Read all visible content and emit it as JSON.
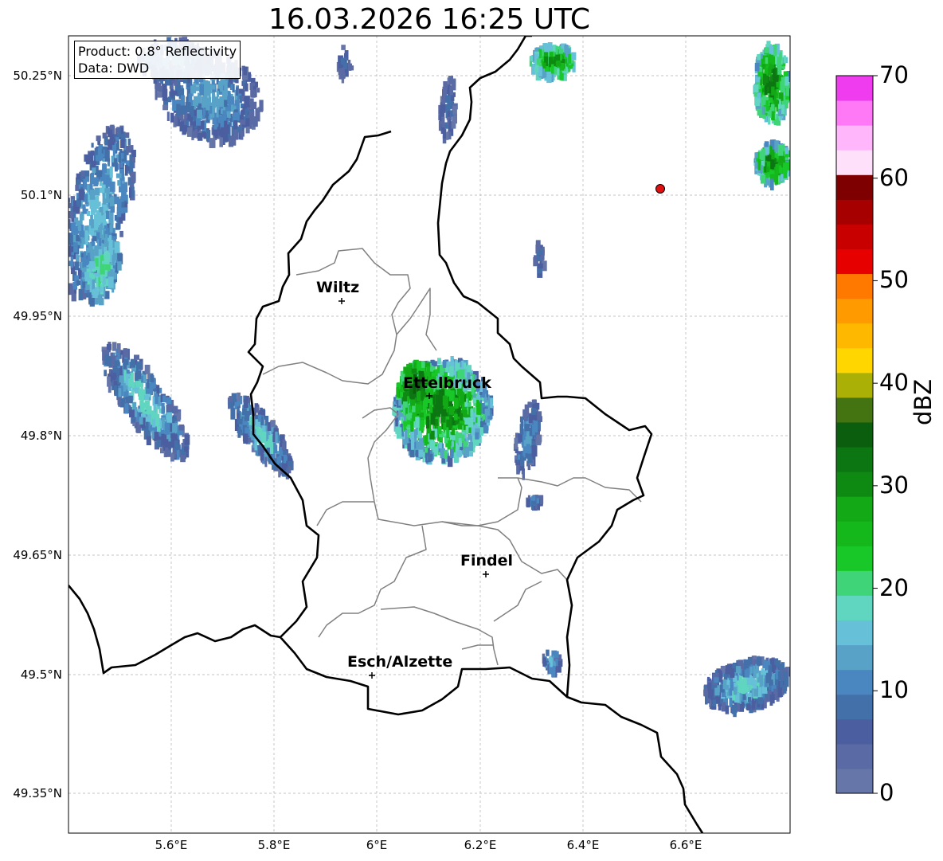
{
  "title": "16.03.2026 16:25 UTC",
  "info": {
    "product": "Product: 0.8° Reflectivity",
    "data": "Data: DWD"
  },
  "axes": {
    "lat_ticks": [
      "50.25°N",
      "50.1°N",
      "49.95°N",
      "49.8°N",
      "49.65°N",
      "49.5°N",
      "49.35°N"
    ],
    "lon_ticks": [
      "5.6°E",
      "5.8°E",
      "6°E",
      "6.2°E",
      "6.4°E",
      "6.6°E"
    ]
  },
  "cities": [
    {
      "name": "Wiltz"
    },
    {
      "name": "Ettelbruck"
    },
    {
      "name": "Findel"
    },
    {
      "name": "Esch/Alzette"
    }
  ],
  "colorbar": {
    "label": "dBZ",
    "ticks": [
      "0",
      "10",
      "20",
      "30",
      "40",
      "50",
      "60",
      "70"
    ],
    "colors": [
      "#6676a8",
      "#5a6aa4",
      "#4a5ea0",
      "#4470aa",
      "#4a86c0",
      "#58a2c8",
      "#66c0d8",
      "#60d6c0",
      "#40d478",
      "#18c828",
      "#14b81a",
      "#12a816",
      "#0e8a12",
      "#0c7612",
      "#0a5e0e",
      "#447412",
      "#aab006",
      "#ffd600",
      "#ffb800",
      "#ff9a00",
      "#ff7800",
      "#e60000",
      "#c80000",
      "#a60000",
      "#7e0000",
      "#ffe0fa",
      "#ffb6fa",
      "#ff78f6",
      "#ee3cee"
    ]
  },
  "colors": {
    "border": "#000000",
    "canton": "#808080",
    "grid": "#b0b0b0",
    "marker": "#e01010"
  }
}
